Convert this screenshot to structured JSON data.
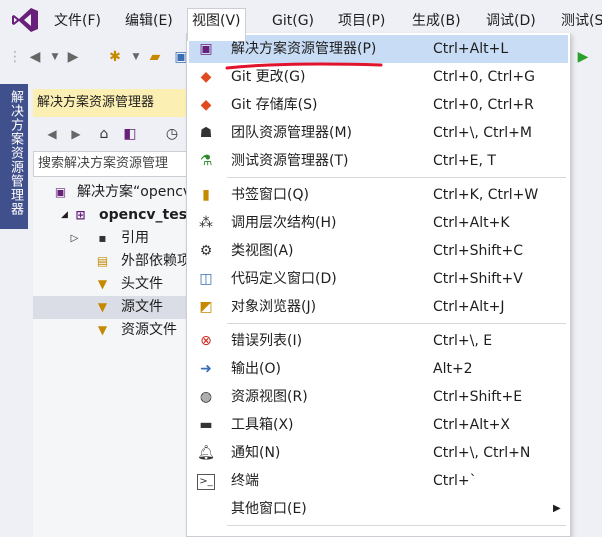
{
  "menubar": {
    "items": [
      {
        "label": "文件(F)"
      },
      {
        "label": "编辑(E)"
      },
      {
        "label": "视图(V)"
      },
      {
        "label": "Git(G)"
      },
      {
        "label": "项目(P)"
      },
      {
        "label": "生成(B)"
      },
      {
        "label": "调试(D)"
      },
      {
        "label": "测试(S"
      }
    ]
  },
  "sidebar": {
    "tab_label": "解决方案资源管理器"
  },
  "panel": {
    "title": "解决方案资源管理器",
    "search_placeholder": "搜索解决方案资源管理",
    "tree": [
      {
        "label": "解决方案“opencv"
      },
      {
        "label": "opencv_test"
      },
      {
        "label": "引用"
      },
      {
        "label": "外部依赖项"
      },
      {
        "label": "头文件"
      },
      {
        "label": "源文件"
      },
      {
        "label": "资源文件"
      }
    ]
  },
  "view_menu": {
    "items": [
      {
        "label": "解决方案资源管理器(P)",
        "shortcut": "Ctrl+Alt+L"
      },
      {
        "label": "Git 更改(G)",
        "shortcut": "Ctrl+0, Ctrl+G"
      },
      {
        "label": "Git 存储库(S)",
        "shortcut": "Ctrl+0, Ctrl+R"
      },
      {
        "label": "团队资源管理器(M)",
        "shortcut": "Ctrl+\\, Ctrl+M"
      },
      {
        "label": "测试资源管理器(T)",
        "shortcut": "Ctrl+E, T"
      },
      {
        "label": "书签窗口(Q)",
        "shortcut": "Ctrl+K, Ctrl+W"
      },
      {
        "label": "调用层次结构(H)",
        "shortcut": "Ctrl+Alt+K"
      },
      {
        "label": "类视图(A)",
        "shortcut": "Ctrl+Shift+C"
      },
      {
        "label": "代码定义窗口(D)",
        "shortcut": "Ctrl+Shift+V"
      },
      {
        "label": "对象浏览器(J)",
        "shortcut": "Ctrl+Alt+J"
      },
      {
        "label": "错误列表(I)",
        "shortcut": "Ctrl+\\, E"
      },
      {
        "label": "输出(O)",
        "shortcut": "Alt+2"
      },
      {
        "label": "资源视图(R)",
        "shortcut": "Ctrl+Shift+E"
      },
      {
        "label": "工具箱(X)",
        "shortcut": "Ctrl+Alt+X"
      },
      {
        "label": "通知(N)",
        "shortcut": "Ctrl+\\, Ctrl+N"
      },
      {
        "label": "终端",
        "shortcut": "Ctrl+`"
      },
      {
        "label": "其他窗口(E)",
        "shortcut": ""
      }
    ]
  },
  "colors": {
    "accent": "#68217a",
    "highlight": "#c9dcf5",
    "annotation": "#e0142c",
    "sidetab": "#40508c"
  }
}
